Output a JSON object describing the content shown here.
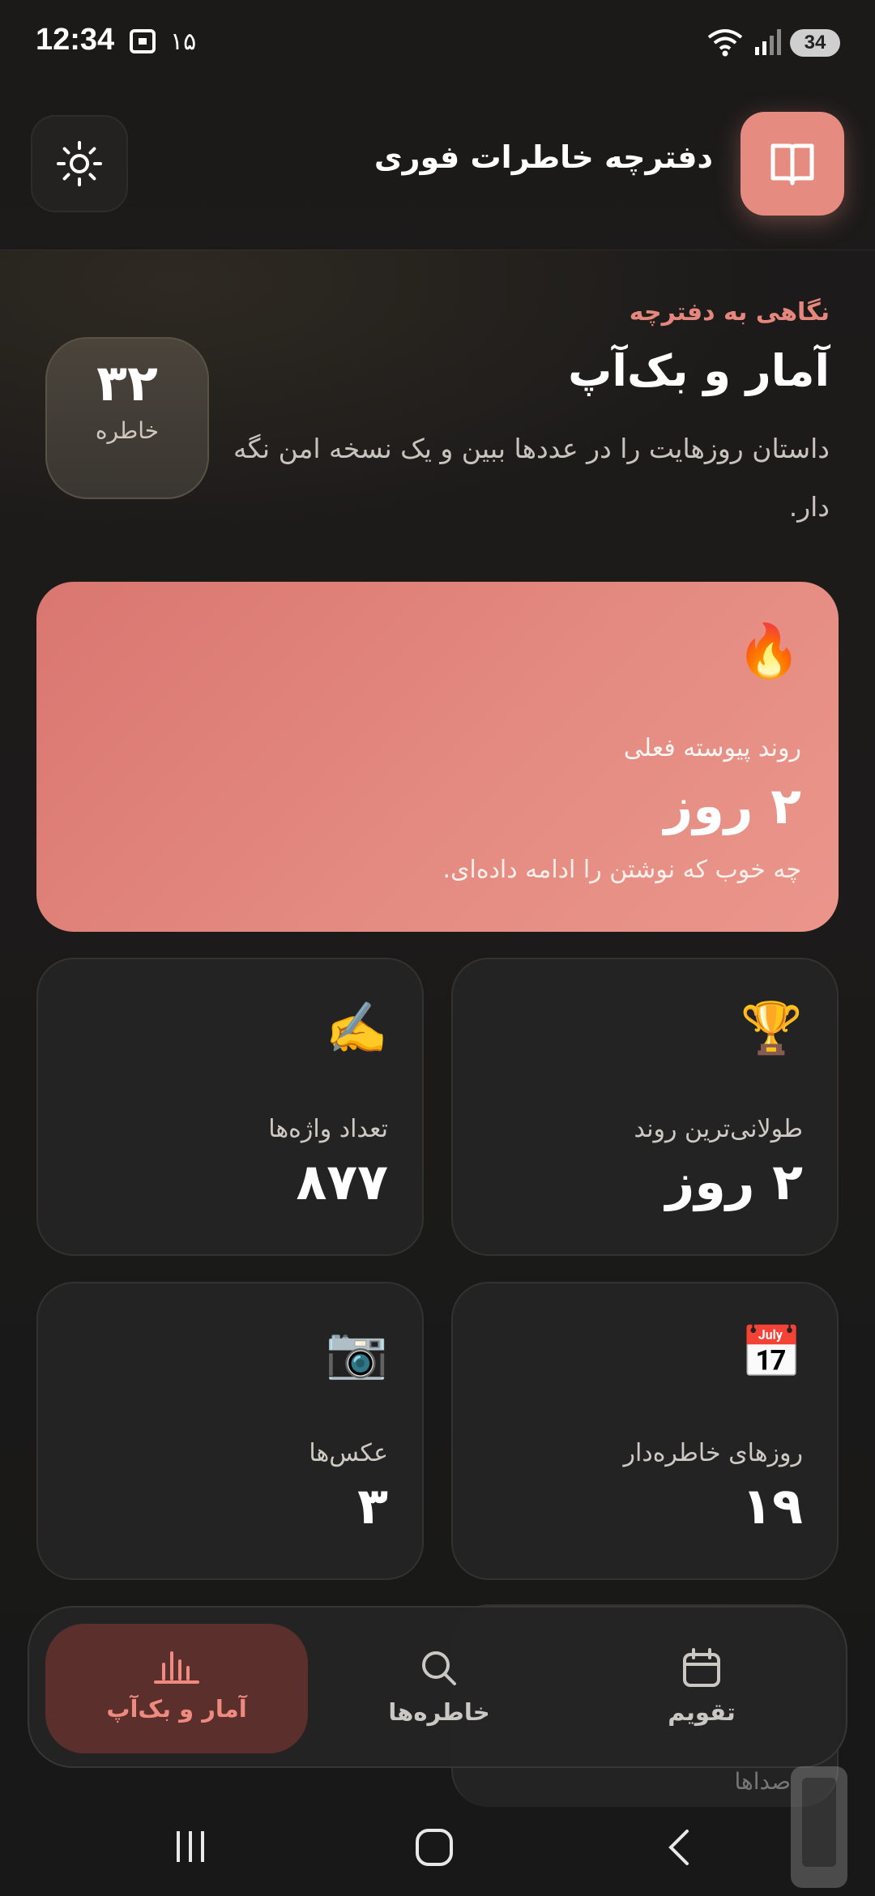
{
  "status_bar": {
    "time": "12:34",
    "notif_count": "۱۵",
    "battery": "34"
  },
  "header": {
    "title": "دفترچه خاطرات فوری",
    "theme_toggle_icon": "sun-icon",
    "logo_icon": "book-icon"
  },
  "hero": {
    "eyebrow": "نگاهی به دفترچه",
    "title": "آمار و بک‌آپ",
    "description": "داستان روزهایت را در عددها ببین و یک نسخه امن نگه دار.",
    "memory_count": "۳۲",
    "memory_count_label": "خاطره"
  },
  "streak_card": {
    "emoji": "🔥",
    "label": "روند پیوسته فعلی",
    "value": "۲ روز",
    "subtitle": "چه خوب که نوشتن را ادامه داده‌ای.",
    "color": "#e5877d"
  },
  "stats": [
    {
      "emoji": "🏆",
      "label": "طولانی‌ترین روند",
      "value": "۲ روز"
    },
    {
      "emoji": "✍️",
      "label": "تعداد واژه‌ها",
      "value": "۸۷۷"
    },
    {
      "emoji": "📅",
      "label": "روزهای خاطره‌دار",
      "value": "۱۹"
    },
    {
      "emoji": "📷",
      "label": "عکس‌ها",
      "value": "۳"
    }
  ],
  "peek_text": "صداها",
  "bottom_nav": {
    "items": [
      {
        "label": "آمار و بک‌آپ",
        "icon": "bar-chart-icon",
        "active": true
      },
      {
        "label": "خاطره‌ها",
        "icon": "search-icon",
        "active": false
      },
      {
        "label": "تقویم",
        "icon": "calendar-icon",
        "active": false
      }
    ]
  },
  "colors": {
    "accent": "#e5877d",
    "background": "#1b1a19",
    "card": "#232323",
    "nav_active": "#5a2f2c"
  }
}
